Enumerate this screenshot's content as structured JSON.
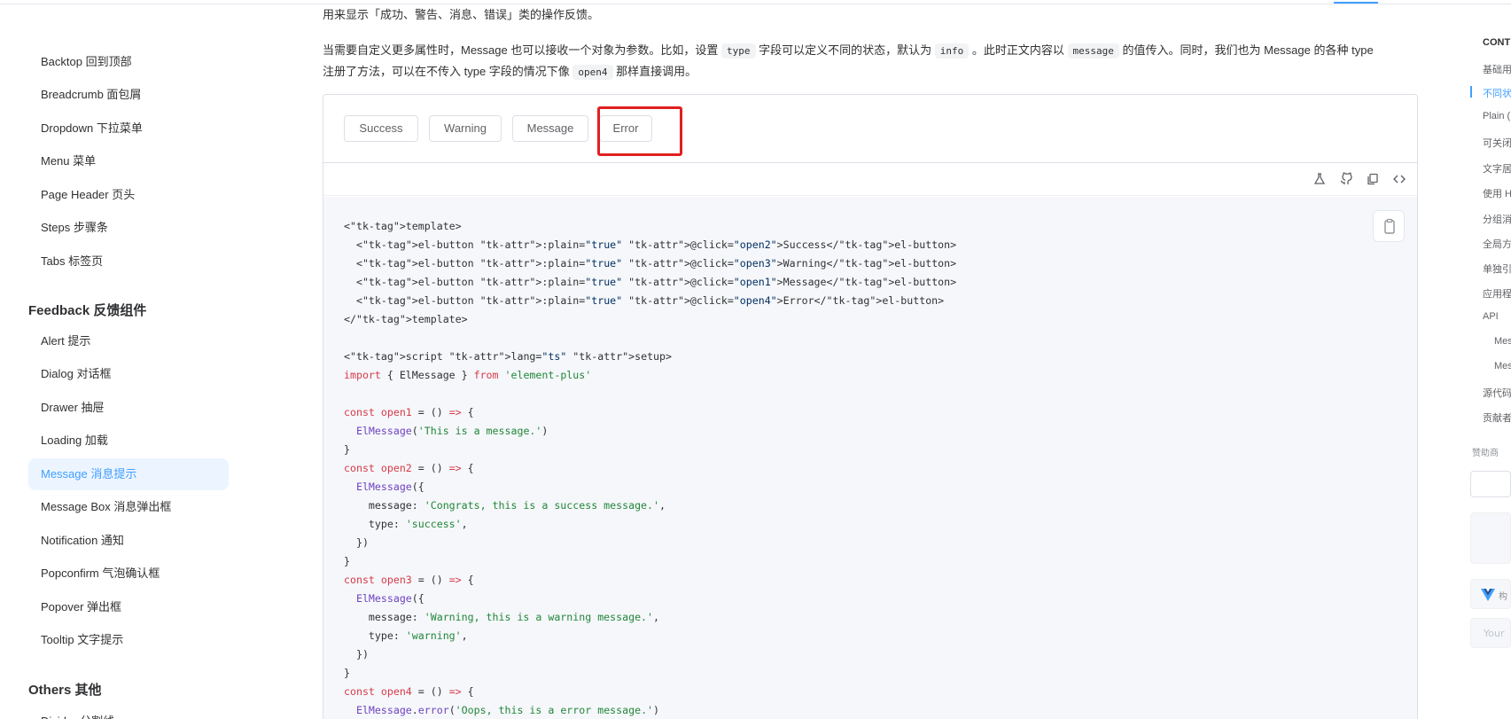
{
  "sidebar": {
    "items_top": [
      "Backtop 回到顶部",
      "Breadcrumb 面包屑",
      "Dropdown 下拉菜单",
      "Menu 菜单",
      "Page Header 页头",
      "Steps 步骤条",
      "Tabs 标签页"
    ],
    "group_feedback": "Feedback 反馈组件",
    "items_feedback": [
      "Alert 提示",
      "Dialog 对话框",
      "Drawer 抽屉",
      "Loading 加载",
      "Message 消息提示",
      "Message Box 消息弹出框",
      "Notification 通知",
      "Popconfirm 气泡确认框",
      "Popover 弹出框",
      "Tooltip 文字提示"
    ],
    "group_others": "Others 其他",
    "items_others": [
      "Divider 分割线"
    ]
  },
  "intro": {
    "line0": "用来显示「成功、警告、消息、错误」类的操作反馈。",
    "p1_a": "当需要自定义更多属性时，Message 也可以接收一个对象为参数。比如，设置",
    "code_type": "type",
    "p1_b": "字段可以定义不同的状态，默认为",
    "code_info": "info",
    "p1_c": "。此时正文内容以",
    "code_message": "message",
    "p1_d": "的值传入。同时，我们也为 Message 的各种 type",
    "p1_e": "注册了方法，可以在不传入 type 字段的情况下像",
    "code_open4": "open4",
    "p1_f": "那样直接调用。"
  },
  "demo": {
    "buttons": [
      "Success",
      "Warning",
      "Message",
      "Error"
    ],
    "toolbar_icons": [
      "flask-icon",
      "github-icon",
      "copy-icon",
      "code-icon"
    ]
  },
  "code_lines": [
    "<template>",
    "  <el-button :plain=\"true\" @click=\"open2\">Success</el-button>",
    "  <el-button :plain=\"true\" @click=\"open3\">Warning</el-button>",
    "  <el-button :plain=\"true\" @click=\"open1\">Message</el-button>",
    "  <el-button :plain=\"true\" @click=\"open4\">Error</el-button>",
    "</template>",
    "",
    "<script lang=\"ts\" setup>",
    "import { ElMessage } from 'element-plus'",
    "",
    "const open1 = () => {",
    "  ElMessage('This is a message.')",
    "}",
    "const open2 = () => {",
    "  ElMessage({",
    "    message: 'Congrats, this is a success message.',",
    "    type: 'success',",
    "  })",
    "}",
    "const open3 = () => {",
    "  ElMessage({",
    "    message: 'Warning, this is a warning message.',",
    "    type: 'warning',",
    "  })",
    "}",
    "const open4 = () => {",
    "  ElMessage.error('Oops, this is a error message.')"
  ],
  "toc": {
    "title": "CONT",
    "items": [
      "基础用",
      "不同状",
      "Plain (",
      "可关闭",
      "文字居",
      "使用 H",
      "分组消",
      "全局方",
      "单独引",
      "应用程",
      "API",
      "Mes",
      "Mes",
      "源代码",
      "贡献者"
    ],
    "sponsor": "赞助商",
    "ad_label": "构",
    "ad_input": "Your"
  },
  "colors": {
    "accent": "#409eff",
    "highlight": "#e02020"
  }
}
